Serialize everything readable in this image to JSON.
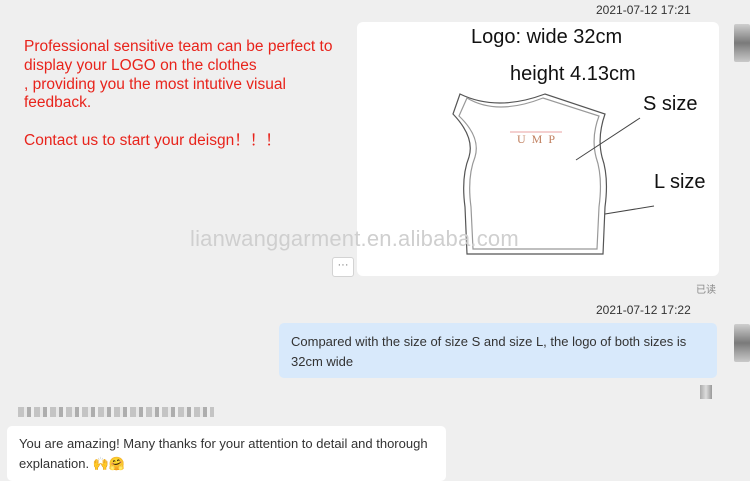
{
  "conversation": {
    "timestamp_1": "2021-07-12 17:21",
    "timestamp_2": "2021-07-12 17:22",
    "promo_text": "Professional sensitive team can be perfect to display your LOGO on the clothes\n, providing you the most intutive visual feedback.\n\nContact us to start your deisgn！！！",
    "image_card": {
      "logo_width": "Logo: wide 32cm",
      "height": "height 4.13cm",
      "s_size": "S  size",
      "l_size": "L size",
      "shirt_logo": "UMP"
    },
    "watermark": "lianwanggarment.en.alibaba.com",
    "more_button": "···",
    "read_status": "已读",
    "reply_message": "Compared with the size of size S and size L, the logo of both sizes is 32cm wide",
    "customer_message": "You are amazing! Many thanks for your attention to detail and thorough explanation.",
    "customer_emoji": "🙌🤗"
  }
}
